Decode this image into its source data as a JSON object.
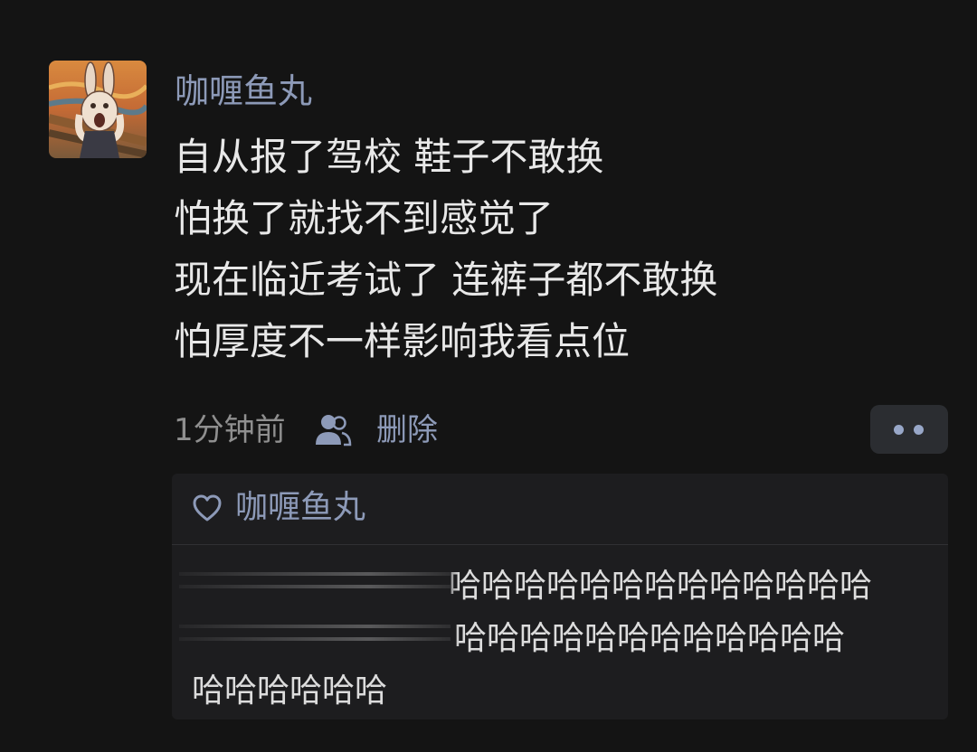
{
  "post": {
    "author": "咖喱鱼丸",
    "avatar_icon": "screaming-rabbit-painting",
    "lines": [
      "自从报了驾校 鞋子不敢换",
      "怕换了就找不到感觉了",
      "现在临近考试了 连裤子都不敢换",
      "怕厚度不一样影响我看点位"
    ],
    "time": "1分钟前",
    "visibility_icon": "friends-icon",
    "delete_label": "删除",
    "more_icon": "more-dots-icon"
  },
  "likes": {
    "icon": "heart-outline-icon",
    "name": "咖喱鱼丸"
  },
  "comment": {
    "lines": [
      "哈哈哈哈哈哈哈哈哈哈哈哈哈",
      "哈哈哈哈哈哈哈哈哈哈哈哈",
      "哈哈哈哈哈哈"
    ]
  },
  "colors": {
    "background": "#141414",
    "link": "#8d9ab8",
    "text": "#e8e8e8",
    "panel": "#1d1d1f"
  }
}
